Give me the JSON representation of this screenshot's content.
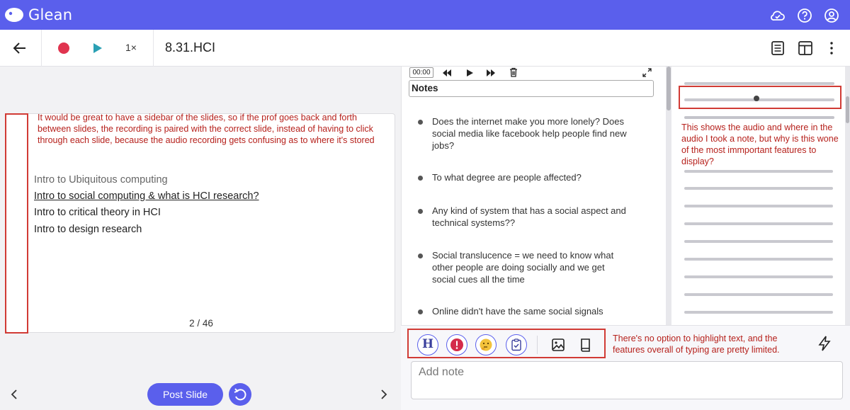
{
  "app": {
    "name": "Glean"
  },
  "header_icons": [
    "cloud-sync-icon",
    "help-icon",
    "account-icon"
  ],
  "toolbar": {
    "speed": "1×",
    "title": "8.31.HCI"
  },
  "slide": {
    "annotation": "It would be great to have a sidebar of the slides, so if the prof goes back and forth between slides, the recording is paired with the correct slide, instead of having to click through each slide, because the audio recording gets confusing as to where it's stored",
    "lines": [
      "Intro to Ubiquitous computing",
      "Intro to social computing & what is HCI research?",
      "Intro to critical theory in HCI",
      "Intro to design research"
    ],
    "counter": "2 / 46"
  },
  "footer": {
    "post_slide": "Post Slide"
  },
  "player": {
    "time": "00:00"
  },
  "notes": {
    "title": "Notes",
    "items": [
      "Does the internet make you more lonely? Does social media like facebook help people find new jobs?",
      "To what degree are people affected?",
      "Any kind of system that has a social aspect and technical systems??",
      "Social translucence = we need to know what other people are doing socially and we get social cues all the time",
      "Online didn't have the same social signals"
    ]
  },
  "waveform": {
    "annotation": "This shows the audio and where in the audio I took a note, but why is this wone of the most immportant features to display?"
  },
  "editor": {
    "annotation": "There's no option to highlight text, and the features overall of typing are pretty limited.",
    "placeholder": "Add note",
    "heading_label": "H"
  },
  "colors": {
    "brand": "#5a5fec",
    "record": "#e0344f",
    "play": "#2aa0b4",
    "annotation": "#b6211c"
  }
}
